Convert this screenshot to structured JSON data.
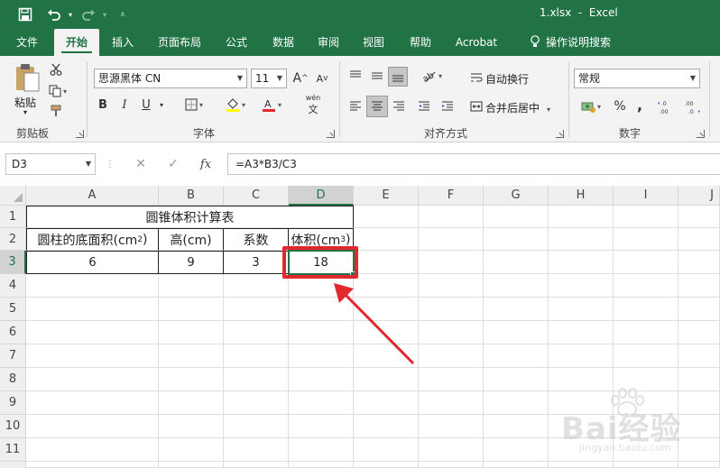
{
  "titlebar": {
    "filename": "1.xlsx",
    "sep": "-",
    "app": "Excel"
  },
  "tabs": [
    "文件",
    "开始",
    "插入",
    "页面布局",
    "公式",
    "数据",
    "审阅",
    "视图",
    "帮助",
    "Acrobat",
    "操作说明搜索"
  ],
  "ribbon": {
    "clipboard": {
      "paste_label": "粘贴",
      "group_label": "剪贴板"
    },
    "font": {
      "font_name": "思源黑体 CN",
      "font_size": "11",
      "bold": "B",
      "italic": "I",
      "underline": "U",
      "grow": "A",
      "shrink": "A",
      "phonetic": "wén",
      "group_label": "字体"
    },
    "alignment": {
      "wrap_text": "自动换行",
      "merge_center": "合并后居中",
      "group_label": "对齐方式"
    },
    "number": {
      "format": "常规",
      "percent": "%",
      "comma": ",",
      "inc_decimal": "←.0 .00",
      "dec_decimal": ".00 →.0",
      "group_label": "数字"
    }
  },
  "formula_bar": {
    "name_box": "D3",
    "fx": "fx",
    "formula": "=A3*B3/C3"
  },
  "grid": {
    "columns": [
      "A",
      "B",
      "C",
      "D",
      "E",
      "F",
      "G",
      "H",
      "I",
      "J"
    ],
    "rows": [
      "1",
      "2",
      "3",
      "4",
      "5",
      "6",
      "7",
      "8",
      "9",
      "10",
      "11"
    ],
    "title": "圆锥体积计算表",
    "headers": {
      "a_main": "圆柱的底面积(cm",
      "a_sup": "2",
      "a_end": ")",
      "b": "高(cm)",
      "c": "系数",
      "d_main": "体积(cm",
      "d_sup": "3",
      "d_end": ")"
    },
    "values": {
      "a": "6",
      "b": "9",
      "c": "3",
      "d": "18"
    }
  },
  "watermark": {
    "brand": "Bai经验",
    "url": "jingyan.baidu.com"
  },
  "colors": {
    "excel_green": "#217346",
    "highlight_red": "#e0282e"
  }
}
